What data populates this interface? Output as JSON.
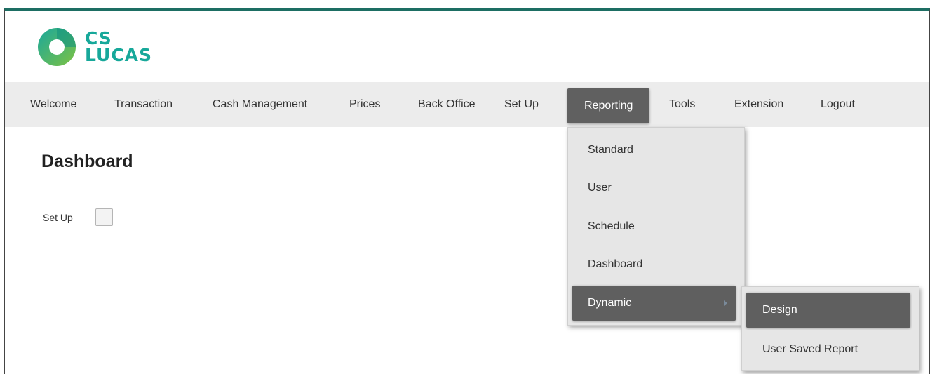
{
  "brand": {
    "line1": "CS",
    "line2": "LUCAS",
    "colors": {
      "teal": "#17a89a",
      "green": "#7dc242",
      "dark": "#1d6e63"
    }
  },
  "nav": {
    "items": [
      {
        "label": "Welcome"
      },
      {
        "label": "Transaction"
      },
      {
        "label": "Cash Management"
      },
      {
        "label": "Prices"
      },
      {
        "label": "Back Office"
      },
      {
        "label": "Set Up"
      },
      {
        "label": "Reporting",
        "active": true
      },
      {
        "label": "Tools"
      },
      {
        "label": "Extension"
      },
      {
        "label": "Logout"
      }
    ]
  },
  "page": {
    "title": "Dashboard",
    "setup_label": "Set Up",
    "setup_checked": false
  },
  "reporting_menu": {
    "items": [
      {
        "label": "Standard"
      },
      {
        "label": "User"
      },
      {
        "label": "Schedule"
      },
      {
        "label": "Dashboard"
      },
      {
        "label": "Dynamic",
        "has_submenu": true,
        "highlighted": true,
        "icon": "chevron-right-icon"
      }
    ]
  },
  "dynamic_submenu": {
    "items": [
      {
        "label": "Design",
        "highlighted": true
      },
      {
        "label": "User Saved Report"
      }
    ]
  },
  "colors": {
    "navbar_bg": "#ececec",
    "active_bg": "#606060",
    "menu_bg": "#e6e6e6"
  }
}
